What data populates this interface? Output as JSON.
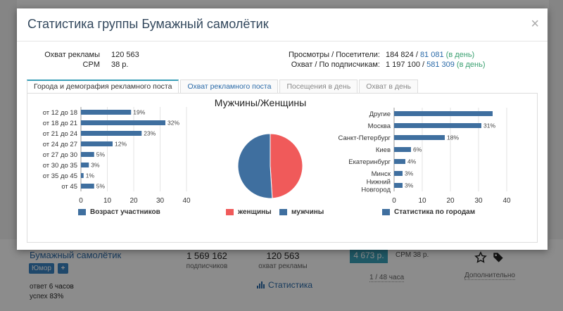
{
  "background": {
    "group_name": "Бумажный самолётик",
    "tag_1": "Юмор",
    "tag_2": "+",
    "reply_label": "ответ",
    "reply_value": "6 часов",
    "success_label": "успех",
    "success_value": "83%",
    "subscribers": "1 569 162",
    "subscribers_caption": "подписчиков",
    "reach": "120 563",
    "reach_caption": "охват рекламы",
    "price": "4 673 р.",
    "cpm": "CPM 38 р.",
    "period": "1 / 48 часа",
    "statistics_link": "Статистика",
    "more_link": "Дополнительно"
  },
  "modal": {
    "title": "Статистика группы Бумажный самолётик",
    "close": "×",
    "summary_left": [
      {
        "key": "Охват рекламы",
        "value": "120 563"
      },
      {
        "key": "CPM",
        "value": "38 р."
      }
    ],
    "summary_right": [
      {
        "key": "Просмотры / Посетители:",
        "v1": "184 824",
        "sep": " / ",
        "v2": "81 081",
        "note": " (в день)"
      },
      {
        "key": "Охват / По подписчикам:",
        "v1": "1 197 100",
        "sep": " / ",
        "v2": "581 309",
        "note": " (в день)"
      }
    ],
    "tabs": [
      {
        "label": "Города и демография рекламного поста",
        "active": true
      },
      {
        "label": "Охват рекламного поста",
        "active": false
      },
      {
        "label": "Посещения в день",
        "active": false
      },
      {
        "label": "Охват в день",
        "active": false
      }
    ]
  },
  "colors": {
    "bar": "#3f6f9f",
    "female": "#f05a5a",
    "male": "#3f6f9f",
    "accent": "#3aa0b8",
    "link": "#2a6aa8"
  },
  "chart_data": [
    {
      "type": "bar",
      "orientation": "horizontal",
      "categories": [
        "от 12 до 18",
        "от 18 до 21",
        "от 21 до 24",
        "от 24 до 27",
        "от 27 до 30",
        "от 30 до 35",
        "от 35 до 45",
        "от 45"
      ],
      "values": [
        19,
        32,
        23,
        12,
        5,
        3,
        1,
        5
      ],
      "labels": [
        "19%",
        "32%",
        "23%",
        "12%",
        "5%",
        "3%",
        "1%",
        "5%"
      ],
      "xticks": [
        "0",
        "10",
        "20",
        "30",
        "40"
      ],
      "xlim": [
        0,
        40
      ],
      "legend": "Возраст участников",
      "grid": true
    },
    {
      "type": "pie",
      "title": "Мужчины/Женщины",
      "slices": [
        {
          "name": "женщины",
          "value": 49
        },
        {
          "name": "мужчины",
          "value": 51
        }
      ],
      "legend_position": "bottom"
    },
    {
      "type": "bar",
      "orientation": "horizontal",
      "categories": [
        "Другие",
        "Москва",
        "Санкт-Петербург",
        "Киев",
        "Екатеринбург",
        "Минск",
        "Нижний Новгород"
      ],
      "values": [
        35,
        31,
        18,
        6,
        4,
        3,
        3
      ],
      "labels": [
        "",
        "31%",
        "18%",
        "6%",
        "4%",
        "3%",
        "3%"
      ],
      "xticks": [
        "0",
        "10",
        "20",
        "30",
        "40"
      ],
      "xlim": [
        0,
        40
      ],
      "legend": "Статистика по городам",
      "grid": true
    }
  ]
}
